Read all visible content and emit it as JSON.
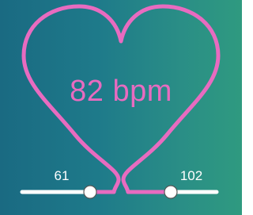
{
  "heart_rate": {
    "display": "82 bpm",
    "value": 82,
    "unit": "bpm",
    "color": "#e86bc0"
  },
  "range": {
    "min_label": "61",
    "max_label": "102",
    "min_value": 61,
    "max_value": 102
  },
  "colors": {
    "background_start": "#1a6a82",
    "background_end": "#2f9a80",
    "heart_outline": "#e86bc0",
    "slider_track": "#ffffff",
    "slider_thumb": "#ffffff"
  }
}
